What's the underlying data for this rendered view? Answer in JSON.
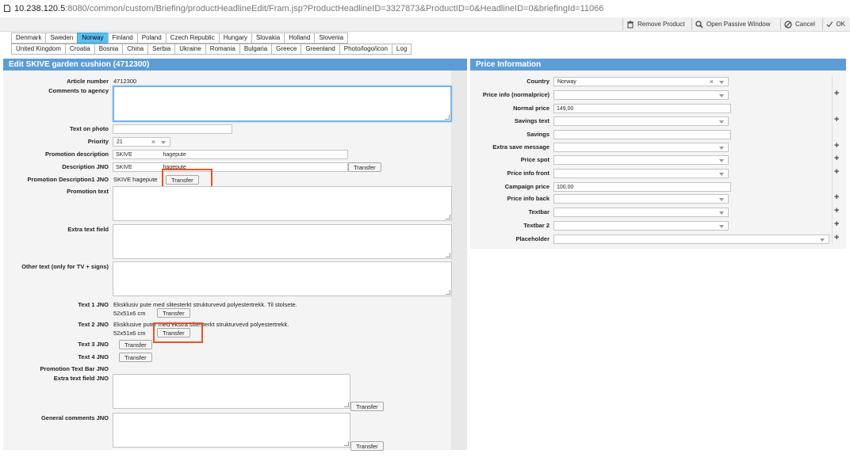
{
  "url": {
    "host": "10.238.120.5",
    "rest": ":8080/common/custom/Briefing/productHeadlineEdit/Fram.jsp?ProductHeadlineID=3327873&ProductID=0&HeadlineID=0&briefingId=11066"
  },
  "toolbar": {
    "remove": "Remove Product",
    "passive": "Open Passive Window",
    "cancel": "Cancel",
    "ok": "OK"
  },
  "tabs_row1": [
    "Denmark",
    "Sweden",
    "Norway",
    "Finland",
    "Poland",
    "Czech Republic",
    "Hungary",
    "Slovakia",
    "Holland",
    "Slovenia"
  ],
  "tabs_row2": [
    "United Kingdom",
    "Croatia",
    "Bosnia",
    "China",
    "Serbia",
    "Ukraine",
    "Romania",
    "Bulgaria",
    "Greece",
    "Greenland",
    "Photo/logo/icon",
    "Log"
  ],
  "edit": {
    "title": "Edit SKIVE garden cushion (4712300)",
    "article_label": "Article number",
    "article_value": "4712300",
    "comments_label": "Comments to agency",
    "text_on_photo_label": "Text on photo",
    "priority_label": "Priority",
    "priority_value": "21",
    "promo_desc_label": "Promotion description",
    "promo_desc_value": "SKIVE                    hagepute",
    "desc_jno_label": "Description JNO",
    "desc_jno_value": "SKIVE                    hagepute",
    "promo_desc1_label": "Promotion Description1 JNO",
    "promo_desc1_value": "SKIVE hagepute",
    "promo_text_label": "Promotion text",
    "extra_text_label": "Extra text field",
    "other_text_label": "Other text (only for TV + signs)",
    "text1_label": "Text 1 JNO",
    "text1_line1": "Eksklusiv pute med slitesterkt strukturvevd polyestertrekk. Til stolsete.",
    "text1_line2": "52x51x6 cm",
    "text2_label": "Text 2 JNO",
    "text2_line1": "Eksklusive puter med ekstra slitesterkt strukturvevd polyestertrekk.",
    "text2_line2": "52x51x6 cm",
    "text3_label": "Text 3 JNO",
    "text4_label": "Text 4 JNO",
    "promo_bar_label": "Promotion Text Bar JNO",
    "extra_jno_label": "Extra text field JNO",
    "general_label": "General comments JNO",
    "transfer": "Transfer"
  },
  "price": {
    "title": "Price Information",
    "country_label": "Country",
    "country_value": "Norway",
    "info_normal_label": "Price info (normalprice)",
    "normal_label": "Normal price",
    "normal_value": "149,00",
    "savings_text_label": "Savings text",
    "savings_label": "Savings",
    "extra_save_label": "Extra save message",
    "spot_label": "Price spot",
    "front_label": "Price info front",
    "campaign_label": "Campaign price",
    "campaign_value": "100,00",
    "back_label": "Price info back",
    "textbar_label": "Textbar",
    "textbar2_label": "Textbar 2",
    "placeholder_label": "Placeholder"
  },
  "colors": {
    "panel_header": "#5d9dd6",
    "active_tab": "#5bc0ea",
    "highlight": "#e8532a"
  }
}
